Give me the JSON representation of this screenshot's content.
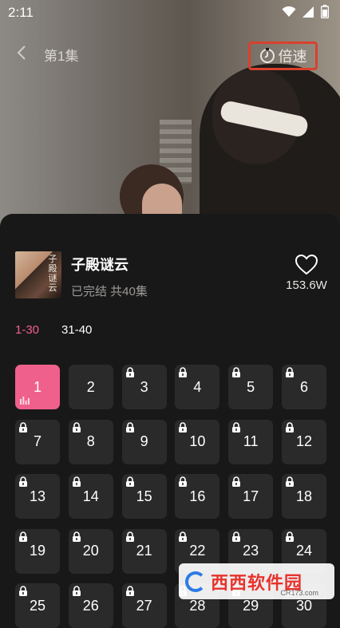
{
  "status_bar": {
    "time": "2:11"
  },
  "player": {
    "episode_title": "第1集",
    "speed_label": "倍速"
  },
  "drama": {
    "title": "子殿谜云",
    "poster_text": "子殿谜云",
    "meta": "已完结 共40集",
    "favorite_count": "153.6W"
  },
  "tabs": [
    {
      "label": "1-30",
      "active": true
    },
    {
      "label": "31-40",
      "active": false
    }
  ],
  "episodes": [
    {
      "num": "1",
      "locked": false,
      "active": true
    },
    {
      "num": "2",
      "locked": false,
      "active": false
    },
    {
      "num": "3",
      "locked": true,
      "active": false
    },
    {
      "num": "4",
      "locked": true,
      "active": false
    },
    {
      "num": "5",
      "locked": true,
      "active": false
    },
    {
      "num": "6",
      "locked": true,
      "active": false
    },
    {
      "num": "7",
      "locked": true,
      "active": false
    },
    {
      "num": "8",
      "locked": true,
      "active": false
    },
    {
      "num": "9",
      "locked": true,
      "active": false
    },
    {
      "num": "10",
      "locked": true,
      "active": false
    },
    {
      "num": "11",
      "locked": true,
      "active": false
    },
    {
      "num": "12",
      "locked": true,
      "active": false
    },
    {
      "num": "13",
      "locked": true,
      "active": false
    },
    {
      "num": "14",
      "locked": true,
      "active": false
    },
    {
      "num": "15",
      "locked": true,
      "active": false
    },
    {
      "num": "16",
      "locked": true,
      "active": false
    },
    {
      "num": "17",
      "locked": true,
      "active": false
    },
    {
      "num": "18",
      "locked": true,
      "active": false
    },
    {
      "num": "19",
      "locked": true,
      "active": false
    },
    {
      "num": "20",
      "locked": true,
      "active": false
    },
    {
      "num": "21",
      "locked": true,
      "active": false
    },
    {
      "num": "22",
      "locked": true,
      "active": false
    },
    {
      "num": "23",
      "locked": true,
      "active": false
    },
    {
      "num": "24",
      "locked": true,
      "active": false
    },
    {
      "num": "25",
      "locked": true,
      "active": false
    },
    {
      "num": "26",
      "locked": true,
      "active": false
    },
    {
      "num": "27",
      "locked": true,
      "active": false
    },
    {
      "num": "28",
      "locked": true,
      "active": false
    },
    {
      "num": "29",
      "locked": true,
      "active": false
    },
    {
      "num": "30",
      "locked": true,
      "active": false
    }
  ],
  "watermark": {
    "brand": "西西软件园",
    "site": "CR173.com"
  },
  "colors": {
    "accent": "#f0608d",
    "highlight_border": "#d9412c",
    "sheet_bg": "#181818",
    "cell_bg": "#2a2a2a"
  },
  "icons": {
    "back": "chevron-left-icon",
    "speed": "timer-icon",
    "favorite": "heart-outline-icon",
    "lock": "lock-icon",
    "playing": "equalizer-icon"
  }
}
